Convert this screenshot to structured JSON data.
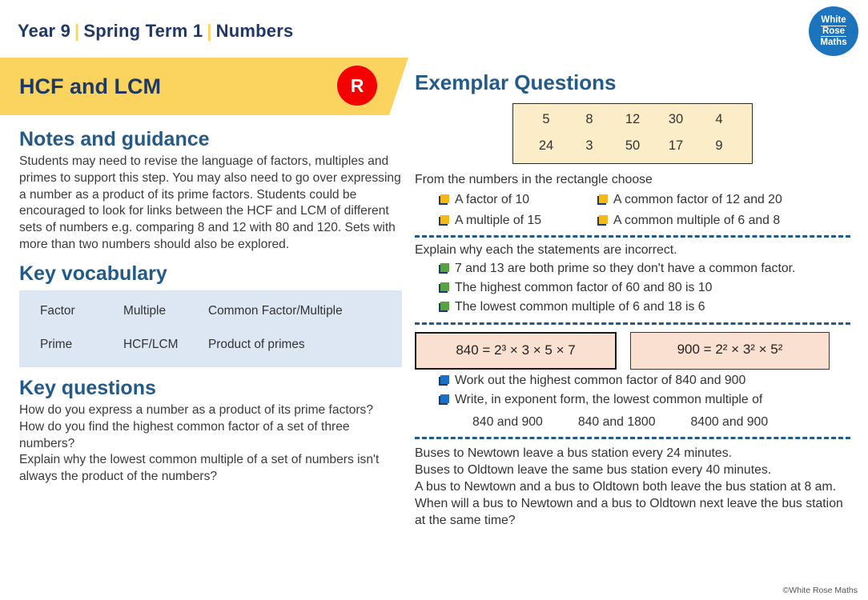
{
  "header": {
    "crumbs": [
      "Year 9",
      "Spring Term 1",
      "Numbers"
    ],
    "separator": "|",
    "accent_yellow": "#FAD45E",
    "navy": "#1F3864"
  },
  "logo": {
    "line1": "White",
    "line2": "Rose",
    "line3": "Maths",
    "color": "#1C75BC"
  },
  "banner": {
    "title": "HCF and LCM",
    "badge": "R",
    "badge_color": "#F40000",
    "bg": "#FAD45E"
  },
  "left": {
    "notes_heading": "Notes and guidance",
    "notes_body": "Students may need to revise the language of factors, multiples and primes to support this step. You may also need to go over expressing a number as a product of its prime factors. Students could be encouraged to look for links between the HCF and LCM of different sets of numbers e.g. comparing 8 and 12 with 80 and 120. Sets with more than two numbers should also be explored.",
    "vocab_heading": "Key vocabulary",
    "vocab_rows": [
      [
        "Factor",
        "Multiple",
        "Common Factor/Multiple"
      ],
      [
        "Prime",
        "HCF/LCM",
        "Product of primes"
      ]
    ],
    "vocab_bg": "#DDE7F3",
    "questions_heading": "Key questions",
    "questions_body": "How do you express a number as a product of its prime factors?\nHow do you find the highest common factor of a set of three numbers?\nExplain why the lowest common multiple of a set of numbers isn't always the product of the numbers?"
  },
  "right": {
    "heading": "Exemplar Questions",
    "number_grid": {
      "bg": "#FBEDC8",
      "rows": [
        [
          "5",
          "8",
          "12",
          "30",
          "4"
        ],
        [
          "24",
          "3",
          "50",
          "17",
          "9"
        ]
      ]
    },
    "task1_lead": "From the numbers in the rectangle choose",
    "task1_items": [
      "A factor of 10",
      "A common factor of 12 and 20",
      "A multiple of 15",
      "A common multiple of 6 and 8"
    ],
    "task2_lead": "Explain why each the statements are incorrect.",
    "task2_items": [
      "7 and 13 are both prime so they don't have a common factor.",
      "The highest common factor of 60 and 80 is 10",
      "The lowest common multiple of 6 and 18 is 6"
    ],
    "equations": [
      {
        "number": "840",
        "factors": "2³ × 3 × 5 × 7",
        "bg": "#FAE0D0"
      },
      {
        "number": "900",
        "factors": "2² × 3² × 5²",
        "bg": "#FAE0D0"
      }
    ],
    "task3_items": [
      "Work out the highest common factor of 840 and 900",
      "Write, in exponent form, the lowest common multiple of"
    ],
    "task3_options": [
      "840 and 900",
      "840 and 1800",
      "8400 and 900"
    ],
    "task4_body": "Buses to Newtown leave a bus station every 24 minutes.\nBuses to Oldtown leave the same bus station every 40 minutes.\nA bus to Newtown and a bus to Oldtown both leave the bus station at 8 am.\nWhen will a bus to Newtown and a bus to Oldtown next leave the bus station at the same time?"
  },
  "footer": {
    "copyright": "©White Rose Maths"
  }
}
